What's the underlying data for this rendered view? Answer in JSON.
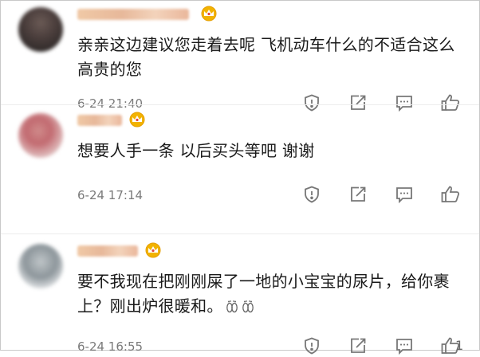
{
  "comments": [
    {
      "text": "亲亲这边建议您走着去呢 飞机动车什么的不适合这么高贵的您",
      "time": "6-24 21:40",
      "likes": ""
    },
    {
      "text": "想要人手一条 以后买头等吧 谢谢",
      "time": "6-24 17:14",
      "likes": ""
    },
    {
      "text": "要不我现在把刚刚屎了一地的小宝宝的尿片，给你裹上？刚出炉很暖和。",
      "time": "6-24 16:55",
      "likes": "1"
    }
  ],
  "icons": {
    "badge": "crown-badge-icon",
    "report": "report-icon",
    "share": "share-icon",
    "reply": "reply-icon",
    "like": "like-icon",
    "emoji": "feet-emoji-icon"
  },
  "colors": {
    "text": "#1a1a1a",
    "time": "#7a7a7a",
    "icon": "#777777",
    "badge": "#f2b300"
  }
}
